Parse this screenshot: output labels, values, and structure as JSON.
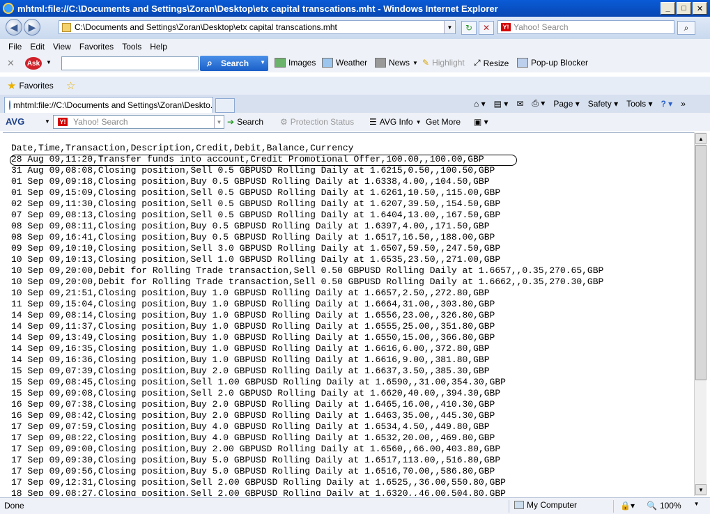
{
  "window": {
    "title": "mhtml:file://C:\\Documents and Settings\\Zoran\\Desktop\\etx capital transcations.mht - Windows Internet Explorer"
  },
  "address": {
    "url": "C:\\Documents and Settings\\Zoran\\Desktop\\etx capital transcations.mht",
    "search_placeholder": "Yahoo! Search"
  },
  "menu": [
    "File",
    "Edit",
    "View",
    "Favorites",
    "Tools",
    "Help"
  ],
  "ask_toolbar": {
    "logo": "Ask",
    "search_label": "Search",
    "images": "Images",
    "weather": "Weather",
    "news": "News",
    "highlight": "Highlight",
    "resize": "Resize",
    "popup_blocker": "Pop-up Blocker"
  },
  "favorites": {
    "label": "Favorites"
  },
  "tab": {
    "label": "mhtml:file://C:\\Documents and Settings\\Zoran\\Deskto..."
  },
  "command_bar": {
    "page": "Page",
    "safety": "Safety",
    "tools": "Tools"
  },
  "avg_toolbar": {
    "logo": "AVG",
    "search_placeholder": "Yahoo! Search",
    "search_label": "Search",
    "protection_status": "Protection Status",
    "avg_info": "AVG Info",
    "get_more": "Get More"
  },
  "content_lines": [
    "Date,Time,Transaction,Description,Credit,Debit,Balance,Currency",
    "28 Aug 09,11:20,Transfer funds into account,Credit Promotional Offer,100.00,,100.00,GBP",
    "31 Aug 09,08:08,Closing position,Sell 0.5 GBPUSD Rolling Daily at 1.6215,0.50,,100.50,GBP",
    "01 Sep 09,09:18,Closing position,Buy 0.5 GBPUSD Rolling Daily at 1.6338,4.00,,104.50,GBP",
    "01 Sep 09,15:09,Closing position,Sell 0.5 GBPUSD Rolling Daily at 1.6261,10.50,,115.00,GBP",
    "02 Sep 09,11:30,Closing position,Sell 0.5 GBPUSD Rolling Daily at 1.6207,39.50,,154.50,GBP",
    "07 Sep 09,08:13,Closing position,Sell 0.5 GBPUSD Rolling Daily at 1.6404,13.00,,167.50,GBP",
    "08 Sep 09,08:11,Closing position,Buy 0.5 GBPUSD Rolling Daily at 1.6397,4.00,,171.50,GBP",
    "08 Sep 09,16:41,Closing position,Buy 0.5 GBPUSD Rolling Daily at 1.6517,16.50,,188.00,GBP",
    "09 Sep 09,10:10,Closing position,Sell 3.0 GBPUSD Rolling Daily at 1.6507,59.50,,247.50,GBP",
    "10 Sep 09,10:13,Closing position,Sell 1.0 GBPUSD Rolling Daily at 1.6535,23.50,,271.00,GBP",
    "10 Sep 09,20:00,Debit for Rolling Trade transaction,Sell 0.50 GBPUSD Rolling Daily at 1.6657,,0.35,270.65,GBP",
    "10 Sep 09,20:00,Debit for Rolling Trade transaction,Sell 0.50 GBPUSD Rolling Daily at 1.6662,,0.35,270.30,GBP",
    "10 Sep 09,21:51,Closing position,Buy 1.0 GBPUSD Rolling Daily at 1.6657,2.50,,272.80,GBP",
    "11 Sep 09,15:04,Closing position,Buy 1.0 GBPUSD Rolling Daily at 1.6664,31.00,,303.80,GBP",
    "14 Sep 09,08:14,Closing position,Buy 1.0 GBPUSD Rolling Daily at 1.6556,23.00,,326.80,GBP",
    "14 Sep 09,11:37,Closing position,Buy 1.0 GBPUSD Rolling Daily at 1.6555,25.00,,351.80,GBP",
    "14 Sep 09,13:49,Closing position,Buy 1.0 GBPUSD Rolling Daily at 1.6550,15.00,,366.80,GBP",
    "14 Sep 09,16:35,Closing position,Buy 1.0 GBPUSD Rolling Daily at 1.6616,6.00,,372.80,GBP",
    "14 Sep 09,16:36,Closing position,Buy 1.0 GBPUSD Rolling Daily at 1.6616,9.00,,381.80,GBP",
    "15 Sep 09,07:39,Closing position,Buy 2.0 GBPUSD Rolling Daily at 1.6637,3.50,,385.30,GBP",
    "15 Sep 09,08:45,Closing position,Sell 1.00 GBPUSD Rolling Daily at 1.6590,,31.00,354.30,GBP",
    "15 Sep 09,09:08,Closing position,Sell 2.0 GBPUSD Rolling Daily at 1.6620,40.00,,394.30,GBP",
    "16 Sep 09,07:38,Closing position,Buy 2.0 GBPUSD Rolling Daily at 1.6465,16.00,,410.30,GBP",
    "16 Sep 09,08:42,Closing position,Buy 2.0 GBPUSD Rolling Daily at 1.6463,35.00,,445.30,GBP",
    "17 Sep 09,07:59,Closing position,Buy 4.0 GBPUSD Rolling Daily at 1.6534,4.50,,449.80,GBP",
    "17 Sep 09,08:22,Closing position,Buy 4.0 GBPUSD Rolling Daily at 1.6532,20.00,,469.80,GBP",
    "17 Sep 09,09:00,Closing position,Buy 2.00 GBPUSD Rolling Daily at 1.6560,,66.00,403.80,GBP",
    "17 Sep 09,09:30,Closing position,Buy 5.0 GBPUSD Rolling Daily at 1.6517,113.00,,516.80,GBP",
    "17 Sep 09,09:56,Closing position,Buy 5.0 GBPUSD Rolling Daily at 1.6516,70.00,,586.80,GBP",
    "17 Sep 09,12:31,Closing position,Sell 2.00 GBPUSD Rolling Daily at 1.6525,,36.00,550.80,GBP",
    "18 Sep 09,08:27,Closing position,Sell 2.00 GBPUSD Rolling Daily at 1.6320,,46.00,504.80,GBP"
  ],
  "status": {
    "text": "Done",
    "zone": "My Computer",
    "zoom": "100%"
  }
}
